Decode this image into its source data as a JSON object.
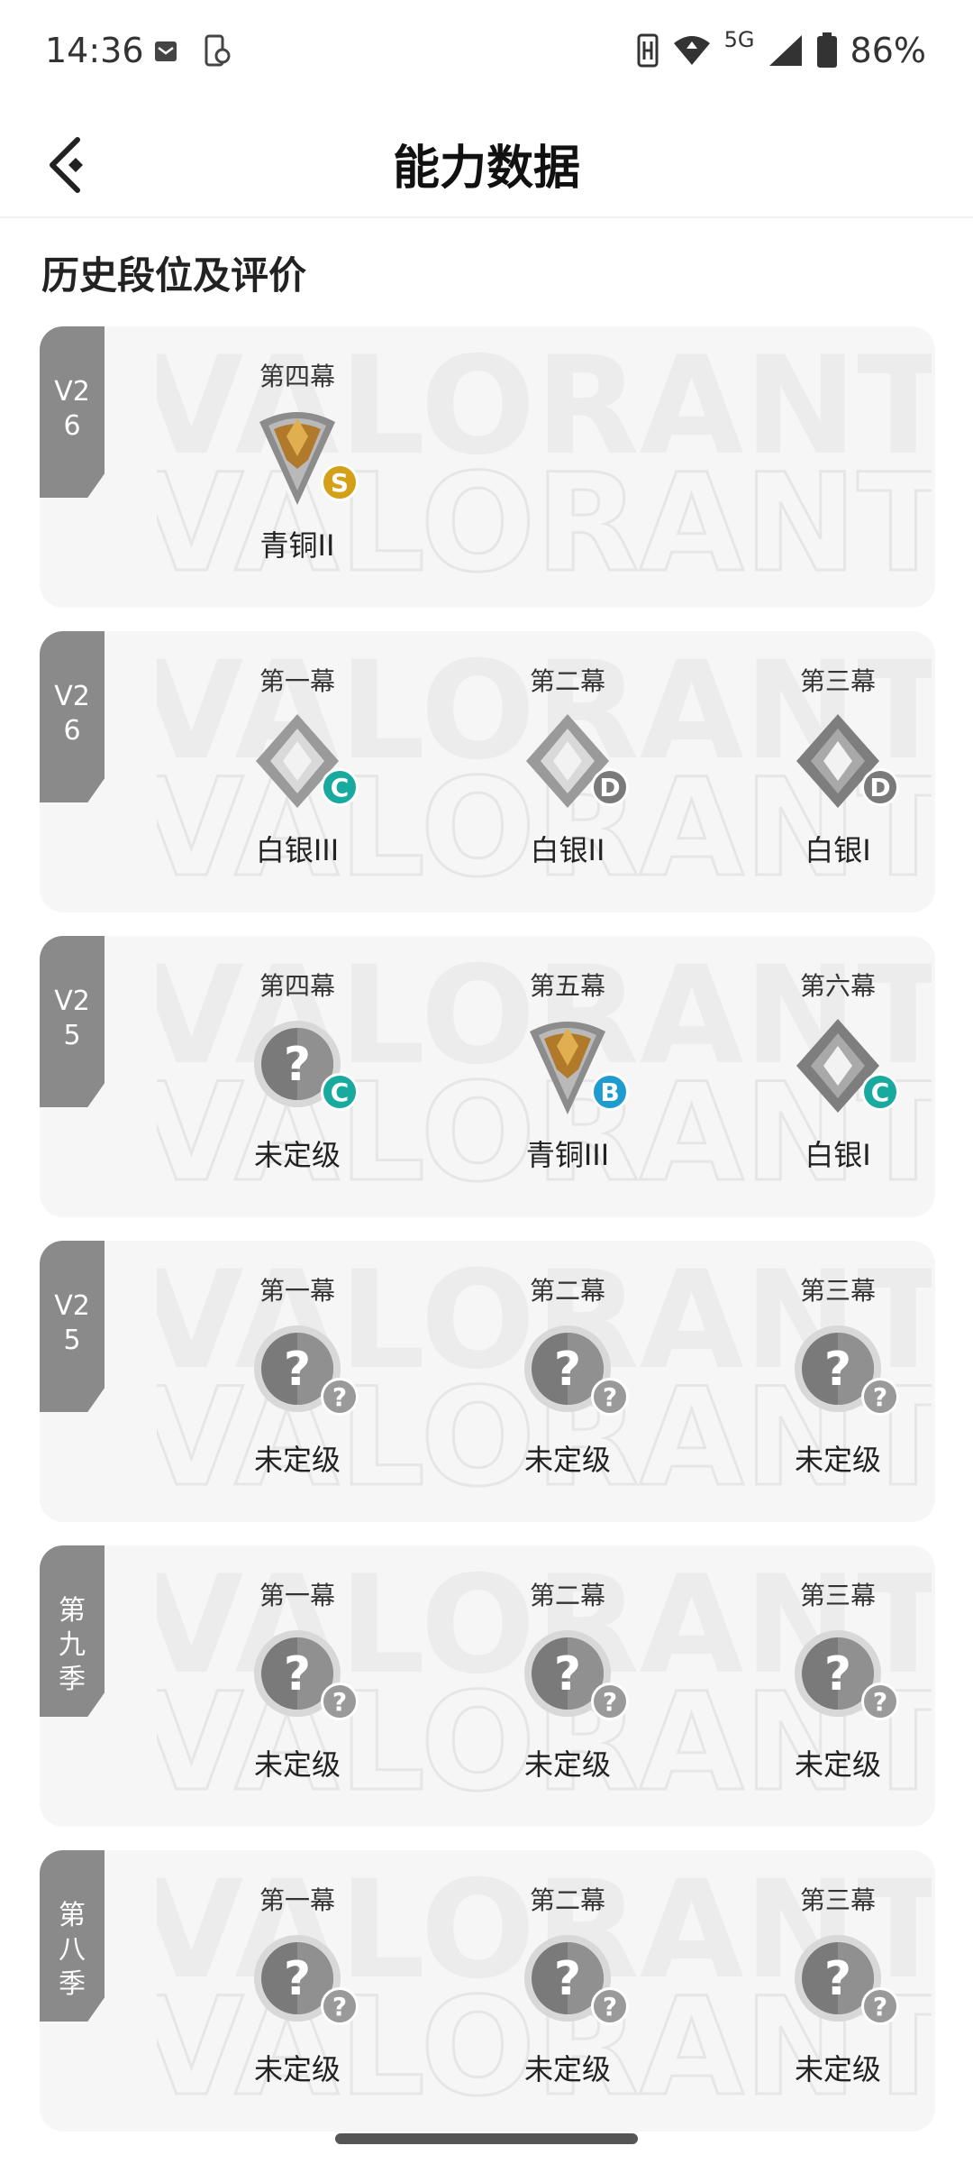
{
  "status_bar": {
    "time": "14:36",
    "network": "5G",
    "battery": "86%",
    "icons": [
      "mail-icon",
      "sync-icon",
      "nfc-icon",
      "wifi-icon",
      "signal-icon",
      "battery-icon"
    ]
  },
  "header": {
    "back_icon": "back-arrow-icon",
    "title": "能力数据"
  },
  "section_title": "历史段位及评价",
  "watermark": "VALORANT",
  "colors": {
    "grade_s": "#d4a017",
    "grade_c": "#18a99f",
    "grade_d": "#7a7a7a",
    "grade_b": "#1e9ccf",
    "grade_q": "#9a9a9a",
    "tag": "#8a8a8a"
  },
  "seasons": [
    {
      "tag": "V26",
      "acts": [
        {
          "act": "第四幕",
          "rank": "青铜II",
          "rank_type": "bronze",
          "grade": "S"
        }
      ]
    },
    {
      "tag": "V26",
      "acts": [
        {
          "act": "第一幕",
          "rank": "白银III",
          "rank_type": "silver",
          "grade": "C"
        },
        {
          "act": "第二幕",
          "rank": "白银II",
          "rank_type": "silver",
          "grade": "D"
        },
        {
          "act": "第三幕",
          "rank": "白银I",
          "rank_type": "silver-dark",
          "grade": "D"
        }
      ]
    },
    {
      "tag": "V25",
      "acts": [
        {
          "act": "第四幕",
          "rank": "未定级",
          "rank_type": "unranked",
          "grade": "C"
        },
        {
          "act": "第五幕",
          "rank": "青铜III",
          "rank_type": "bronze",
          "grade": "B"
        },
        {
          "act": "第六幕",
          "rank": "白银I",
          "rank_type": "silver-dark",
          "grade": "C"
        }
      ]
    },
    {
      "tag": "V25",
      "acts": [
        {
          "act": "第一幕",
          "rank": "未定级",
          "rank_type": "unranked",
          "grade": "?"
        },
        {
          "act": "第二幕",
          "rank": "未定级",
          "rank_type": "unranked",
          "grade": "?"
        },
        {
          "act": "第三幕",
          "rank": "未定级",
          "rank_type": "unranked",
          "grade": "?"
        }
      ]
    },
    {
      "tag": "第九季",
      "acts": [
        {
          "act": "第一幕",
          "rank": "未定级",
          "rank_type": "unranked",
          "grade": "?"
        },
        {
          "act": "第二幕",
          "rank": "未定级",
          "rank_type": "unranked",
          "grade": "?"
        },
        {
          "act": "第三幕",
          "rank": "未定级",
          "rank_type": "unranked",
          "grade": "?"
        }
      ]
    },
    {
      "tag": "第八季",
      "acts": [
        {
          "act": "第一幕",
          "rank": "未定级",
          "rank_type": "unranked",
          "grade": "?"
        },
        {
          "act": "第二幕",
          "rank": "未定级",
          "rank_type": "unranked",
          "grade": "?"
        },
        {
          "act": "第三幕",
          "rank": "未定级",
          "rank_type": "unranked",
          "grade": "?"
        }
      ]
    }
  ]
}
